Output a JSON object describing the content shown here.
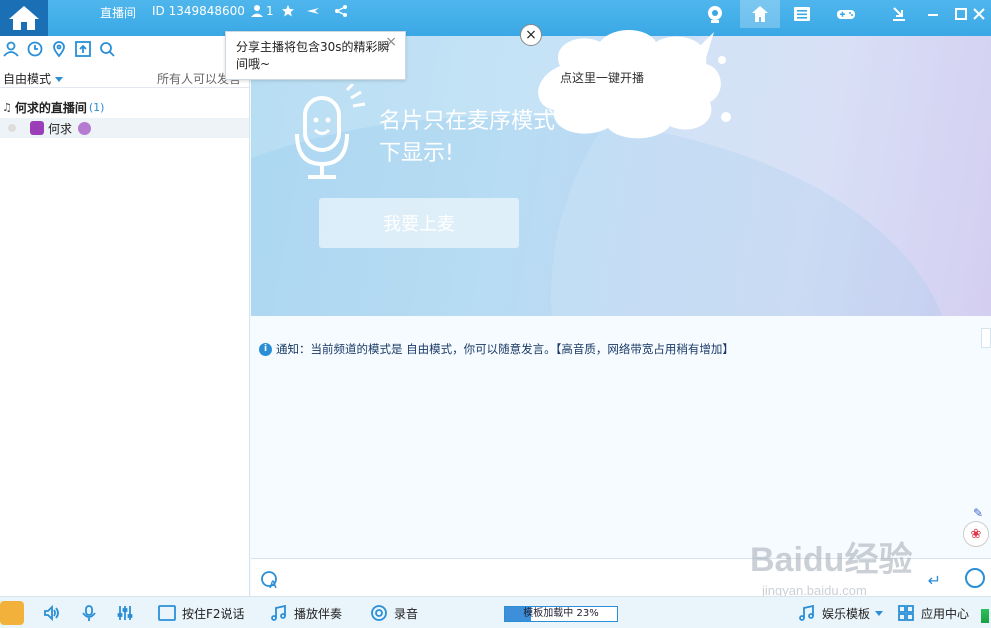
{
  "topbar": {
    "room_name": "直播间",
    "room_id": "ID 1349848600",
    "user_count": "1",
    "buttons": [
      "webcam-icon",
      "home-icon",
      "list-icon",
      "gamepad-icon",
      "download-icon",
      "minimize-icon",
      "maximize-icon",
      "close-icon"
    ]
  },
  "left": {
    "mode": "自由模式",
    "permission": "所有人可以发言",
    "channel": {
      "name": "何求的直播间",
      "count": "(1)"
    },
    "members": [
      {
        "name": "何求"
      }
    ]
  },
  "stage": {
    "headline": "名片只在麦序模式下显示!",
    "go_mic_label": "我要上麦"
  },
  "share_tip": {
    "text": "分享主播将包含30s的精彩瞬间哦~",
    "close": "×"
  },
  "cloud_tip": {
    "text": "点这里一键开播",
    "close": "×"
  },
  "chat": {
    "notice": "通知：当前频道的模式是 自由模式，你可以随意发言。【高音质，网络带宽占用稍有增加】"
  },
  "watermark": {
    "brand": "Baidu经验",
    "url": "jingyan.baidu.com"
  },
  "bottombar": {
    "f2_label": "按住F2说话",
    "accompany_label": "播放伴奏",
    "record_label": "录音",
    "progress_label": "模板加载中 23%",
    "progress_value": 23,
    "template_label": "娱乐模板",
    "app_center_label": "应用中心"
  },
  "colors": {
    "accent": "#2a8fd6",
    "topbar": "#3aa8e6"
  }
}
